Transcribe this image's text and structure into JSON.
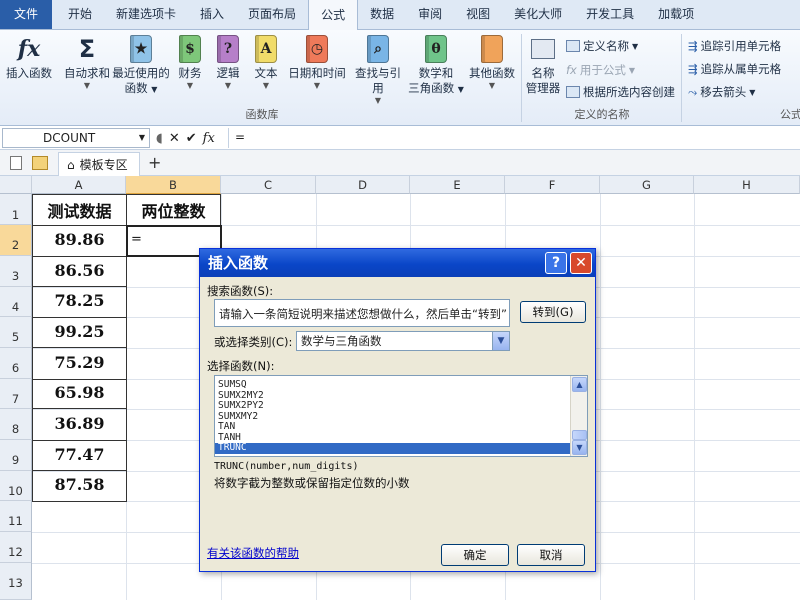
{
  "ribbon_tabs": [
    "文件",
    "开始",
    "新建选项卡",
    "插入",
    "页面布局",
    "公式",
    "数据",
    "审阅",
    "视图",
    "美化大师",
    "开发工具",
    "加载项"
  ],
  "ribbon": {
    "insert_function": "插入函数",
    "autosum_line1": "自动求和",
    "recent_line1": "最近使用的",
    "recent_line2": "函数",
    "financial": "财务",
    "logical": "逻辑",
    "text": "文本",
    "datetime": "日期和时间",
    "lookup": "查找与引用",
    "math_line1": "数学和",
    "math_line2": "三角函数",
    "other": "其他函数",
    "group_function_library": "函数库",
    "name_manager_line1": "名称",
    "name_manager_line2": "管理器",
    "define_name": "定义名称",
    "use_in_formula": "用于公式",
    "create_from_selection": "根据所选内容创建",
    "group_defined_names": "定义的名称",
    "trace_precedents": "追踪引用单元格",
    "trace_dependents": "追踪从属单元格",
    "remove_arrows": "移去箭头",
    "group_formula_audit_partial": "公式"
  },
  "formula_bar": {
    "name_box": "DCOUNT",
    "fx_label": "fx",
    "content": "="
  },
  "doc_tab": {
    "label": "模板专区"
  },
  "columns": [
    "A",
    "B",
    "C",
    "D",
    "E",
    "F",
    "G",
    "H"
  ],
  "rows": [
    "1",
    "2",
    "3",
    "4",
    "5",
    "6",
    "7",
    "8",
    "9",
    "10",
    "11",
    "12",
    "13"
  ],
  "sheet": {
    "header_a": "测试数据",
    "header_b": "两位整数",
    "values": [
      "89.86",
      "86.56",
      "78.25",
      "99.25",
      "75.29",
      "65.98",
      "36.89",
      "77.47",
      "87.58"
    ],
    "b2": "="
  },
  "dialog": {
    "title": "插入函数",
    "help_glyph": "?",
    "close_glyph": "✕",
    "search_label": "搜索函数(S):",
    "search_placeholder": "请输入一条简短说明来描述您想做什么，然后单击“转到”",
    "go_button": "转到(G)",
    "category_label": "或选择类别(C):",
    "category_value": "数学与三角函数",
    "select_label": "选择函数(N):",
    "functions": [
      "SUMSQ",
      "SUMX2MY2",
      "SUMX2PY2",
      "SUMXMY2",
      "TAN",
      "TANH",
      "TRUNC"
    ],
    "selected_function": "TRUNC",
    "signature": "TRUNC(number,num_digits)",
    "description": "将数字截为整数或保留指定位数的小数",
    "help_link": "有关该函数的帮助",
    "ok_button": "确定",
    "cancel_button": "取消"
  }
}
